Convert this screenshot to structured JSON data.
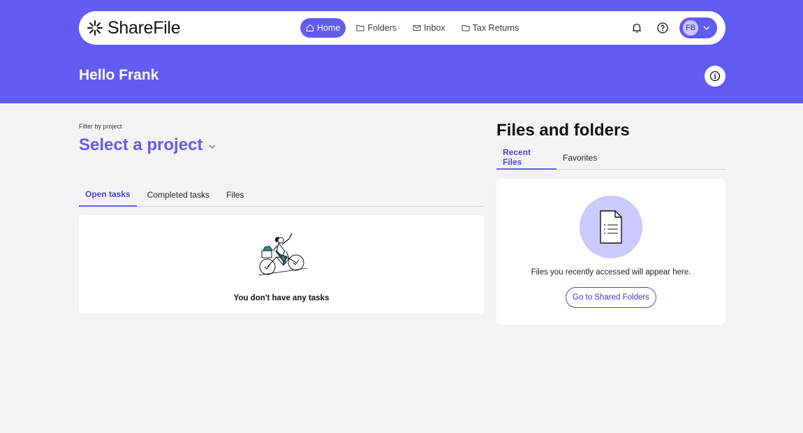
{
  "brand": {
    "name": "ShareFile"
  },
  "nav": {
    "items": [
      {
        "label": "Home",
        "icon": "home-icon",
        "active": true
      },
      {
        "label": "Folders",
        "icon": "folder-icon",
        "active": false
      },
      {
        "label": "Inbox",
        "icon": "mail-icon",
        "active": false
      },
      {
        "label": "Tax Returns",
        "icon": "folder-icon",
        "active": false
      }
    ]
  },
  "account": {
    "initials": "FB"
  },
  "header": {
    "greeting": "Hello Frank"
  },
  "project_filter": {
    "label": "Filter by project",
    "placeholder": "Select a project"
  },
  "tasks": {
    "tabs": [
      "Open tasks",
      "Completed tasks",
      "Files"
    ],
    "active_tab": 0,
    "empty_text": "You don't have any tasks"
  },
  "files": {
    "title": "Files and folders",
    "tabs": [
      "Recent Files",
      "Favorites"
    ],
    "active_tab": 0,
    "empty_text": "Files you recently accessed will appear here.",
    "button_label": "Go to Shared Folders"
  },
  "colors": {
    "brand": "#615bf2",
    "page_bg": "#f3f3f3",
    "doc_circle": "#cbcafc",
    "avatar_bg": "#c9c7fb"
  }
}
